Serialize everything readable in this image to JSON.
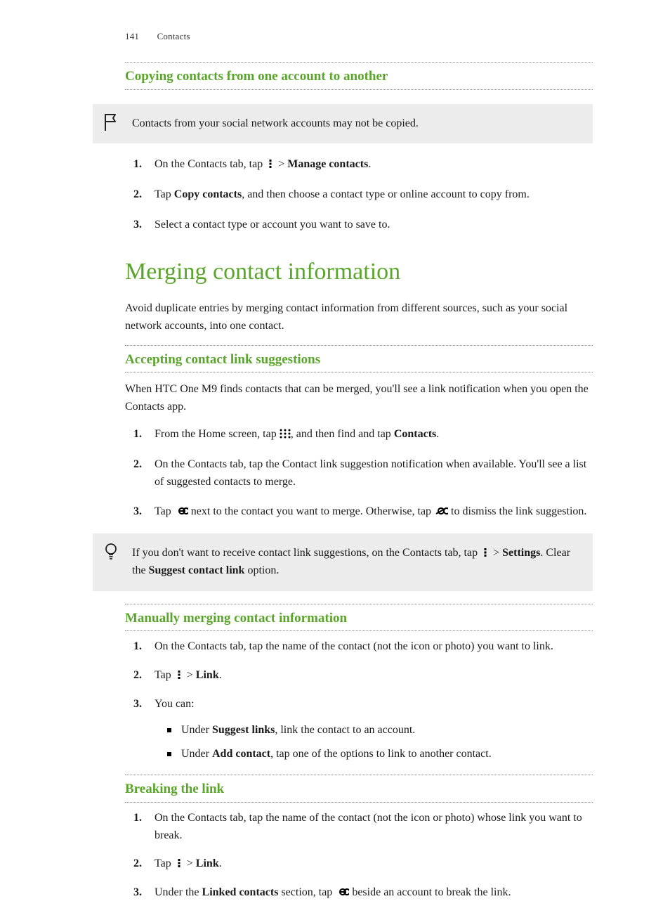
{
  "header": {
    "page_number": "141",
    "section": "Contacts"
  },
  "h_copying": "Copying contacts from one account to another",
  "callout_social": "Contacts from your social network accounts may not be copied.",
  "copy_steps": {
    "s1a": "On the Contacts tab, tap ",
    "s1b": " > ",
    "s1c": "Manage contacts",
    "s1d": ".",
    "s2a": "Tap ",
    "s2b": "Copy contacts",
    "s2c": ", and then choose a contact type or online account to copy from.",
    "s3": "Select a contact type or account you want to save to."
  },
  "h_merging": "Merging contact information",
  "merging_intro": "Avoid duplicate entries by merging contact information from different sources, such as your social network accounts, into one contact.",
  "h_accepting": "Accepting contact link suggestions",
  "accepting_intro": "When HTC One M9 finds contacts that can be merged, you'll see a link notification when you open the Contacts app.",
  "accept_steps": {
    "s1a": "From the Home screen, tap ",
    "s1b": ", and then find and tap ",
    "s1c": "Contacts",
    "s1d": ".",
    "s2": "On the Contacts tab, tap the Contact link suggestion notification when available. You'll see a list of suggested contacts to merge.",
    "s3a": "Tap ",
    "s3b": " next to the contact you want to merge. Otherwise, tap ",
    "s3c": " to dismiss the link suggestion."
  },
  "callout_tip_a": "If you don't want to receive contact link suggestions, on the Contacts tab, tap ",
  "callout_tip_b": " > ",
  "callout_tip_c": "Settings",
  "callout_tip_d": ". Clear the ",
  "callout_tip_e": "Suggest contact link",
  "callout_tip_f": " option.",
  "h_manual": "Manually merging contact information",
  "manual_steps": {
    "s1": "On the Contacts tab, tap the name of the contact (not the icon or photo) you want to link.",
    "s2a": "Tap ",
    "s2b": " > ",
    "s2c": "Link",
    "s2d": ".",
    "s3": "You can:",
    "b1a": "Under ",
    "b1b": "Suggest links",
    "b1c": ", link the contact to an account.",
    "b2a": "Under ",
    "b2b": "Add contact",
    "b2c": ", tap one of the options to link to another contact."
  },
  "h_breaking": "Breaking the link",
  "break_steps": {
    "s1": "On the Contacts tab, tap the name of the contact (not the icon or photo) whose link you want to break.",
    "s2a": "Tap ",
    "s2b": " > ",
    "s2c": "Link",
    "s2d": ".",
    "s3a": "Under the ",
    "s3b": "Linked contacts",
    "s3c": " section, tap ",
    "s3d": " beside an account to break the link."
  }
}
